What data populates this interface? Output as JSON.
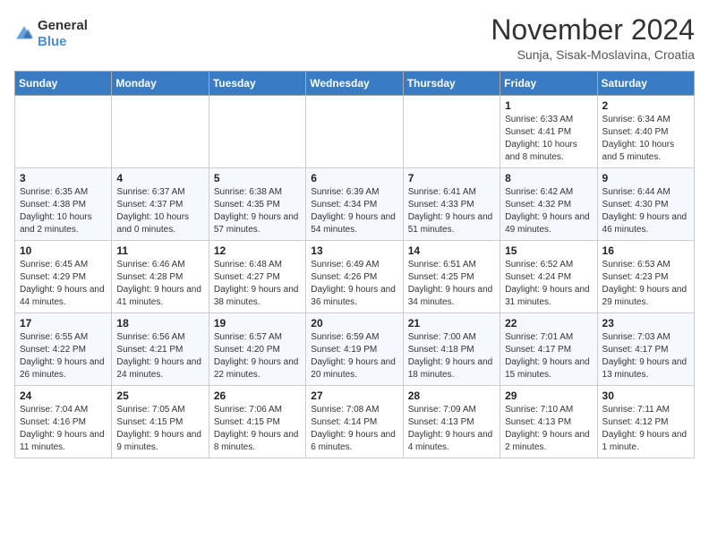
{
  "logo": {
    "general": "General",
    "blue": "Blue"
  },
  "title": "November 2024",
  "subtitle": "Sunja, Sisak-Moslavina, Croatia",
  "days_of_week": [
    "Sunday",
    "Monday",
    "Tuesday",
    "Wednesday",
    "Thursday",
    "Friday",
    "Saturday"
  ],
  "weeks": [
    [
      {
        "day": "",
        "info": ""
      },
      {
        "day": "",
        "info": ""
      },
      {
        "day": "",
        "info": ""
      },
      {
        "day": "",
        "info": ""
      },
      {
        "day": "",
        "info": ""
      },
      {
        "day": "1",
        "info": "Sunrise: 6:33 AM\nSunset: 4:41 PM\nDaylight: 10 hours and 8 minutes."
      },
      {
        "day": "2",
        "info": "Sunrise: 6:34 AM\nSunset: 4:40 PM\nDaylight: 10 hours and 5 minutes."
      }
    ],
    [
      {
        "day": "3",
        "info": "Sunrise: 6:35 AM\nSunset: 4:38 PM\nDaylight: 10 hours and 2 minutes."
      },
      {
        "day": "4",
        "info": "Sunrise: 6:37 AM\nSunset: 4:37 PM\nDaylight: 10 hours and 0 minutes."
      },
      {
        "day": "5",
        "info": "Sunrise: 6:38 AM\nSunset: 4:35 PM\nDaylight: 9 hours and 57 minutes."
      },
      {
        "day": "6",
        "info": "Sunrise: 6:39 AM\nSunset: 4:34 PM\nDaylight: 9 hours and 54 minutes."
      },
      {
        "day": "7",
        "info": "Sunrise: 6:41 AM\nSunset: 4:33 PM\nDaylight: 9 hours and 51 minutes."
      },
      {
        "day": "8",
        "info": "Sunrise: 6:42 AM\nSunset: 4:32 PM\nDaylight: 9 hours and 49 minutes."
      },
      {
        "day": "9",
        "info": "Sunrise: 6:44 AM\nSunset: 4:30 PM\nDaylight: 9 hours and 46 minutes."
      }
    ],
    [
      {
        "day": "10",
        "info": "Sunrise: 6:45 AM\nSunset: 4:29 PM\nDaylight: 9 hours and 44 minutes."
      },
      {
        "day": "11",
        "info": "Sunrise: 6:46 AM\nSunset: 4:28 PM\nDaylight: 9 hours and 41 minutes."
      },
      {
        "day": "12",
        "info": "Sunrise: 6:48 AM\nSunset: 4:27 PM\nDaylight: 9 hours and 38 minutes."
      },
      {
        "day": "13",
        "info": "Sunrise: 6:49 AM\nSunset: 4:26 PM\nDaylight: 9 hours and 36 minutes."
      },
      {
        "day": "14",
        "info": "Sunrise: 6:51 AM\nSunset: 4:25 PM\nDaylight: 9 hours and 34 minutes."
      },
      {
        "day": "15",
        "info": "Sunrise: 6:52 AM\nSunset: 4:24 PM\nDaylight: 9 hours and 31 minutes."
      },
      {
        "day": "16",
        "info": "Sunrise: 6:53 AM\nSunset: 4:23 PM\nDaylight: 9 hours and 29 minutes."
      }
    ],
    [
      {
        "day": "17",
        "info": "Sunrise: 6:55 AM\nSunset: 4:22 PM\nDaylight: 9 hours and 26 minutes."
      },
      {
        "day": "18",
        "info": "Sunrise: 6:56 AM\nSunset: 4:21 PM\nDaylight: 9 hours and 24 minutes."
      },
      {
        "day": "19",
        "info": "Sunrise: 6:57 AM\nSunset: 4:20 PM\nDaylight: 9 hours and 22 minutes."
      },
      {
        "day": "20",
        "info": "Sunrise: 6:59 AM\nSunset: 4:19 PM\nDaylight: 9 hours and 20 minutes."
      },
      {
        "day": "21",
        "info": "Sunrise: 7:00 AM\nSunset: 4:18 PM\nDaylight: 9 hours and 18 minutes."
      },
      {
        "day": "22",
        "info": "Sunrise: 7:01 AM\nSunset: 4:17 PM\nDaylight: 9 hours and 15 minutes."
      },
      {
        "day": "23",
        "info": "Sunrise: 7:03 AM\nSunset: 4:17 PM\nDaylight: 9 hours and 13 minutes."
      }
    ],
    [
      {
        "day": "24",
        "info": "Sunrise: 7:04 AM\nSunset: 4:16 PM\nDaylight: 9 hours and 11 minutes."
      },
      {
        "day": "25",
        "info": "Sunrise: 7:05 AM\nSunset: 4:15 PM\nDaylight: 9 hours and 9 minutes."
      },
      {
        "day": "26",
        "info": "Sunrise: 7:06 AM\nSunset: 4:15 PM\nDaylight: 9 hours and 8 minutes."
      },
      {
        "day": "27",
        "info": "Sunrise: 7:08 AM\nSunset: 4:14 PM\nDaylight: 9 hours and 6 minutes."
      },
      {
        "day": "28",
        "info": "Sunrise: 7:09 AM\nSunset: 4:13 PM\nDaylight: 9 hours and 4 minutes."
      },
      {
        "day": "29",
        "info": "Sunrise: 7:10 AM\nSunset: 4:13 PM\nDaylight: 9 hours and 2 minutes."
      },
      {
        "day": "30",
        "info": "Sunrise: 7:11 AM\nSunset: 4:12 PM\nDaylight: 9 hours and 1 minute."
      }
    ]
  ]
}
